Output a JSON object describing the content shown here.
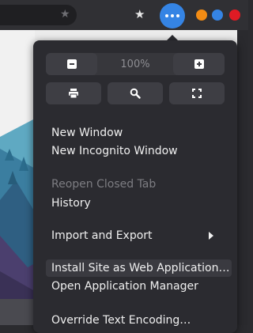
{
  "window": {
    "colors": {
      "accent": "#3584e4",
      "minimize": "#f38c14",
      "maximize": "#3584e4",
      "close": "#e01b24"
    }
  },
  "toolbar": {
    "url_star_icon": "star-icon",
    "bookmark_icon": "star-icon",
    "menu_icon": "more-horizontal-icon"
  },
  "menu": {
    "zoom": {
      "out_icon": "zoom-out-icon",
      "level": "100%",
      "in_icon": "zoom-in-icon"
    },
    "tools": [
      {
        "icon": "print-icon"
      },
      {
        "icon": "search-icon"
      },
      {
        "icon": "fullscreen-icon"
      }
    ],
    "items": [
      {
        "label": "New Window",
        "enabled": true
      },
      {
        "label": "New Incognito Window",
        "enabled": true
      },
      {
        "label": "Reopen Closed Tab",
        "enabled": false
      },
      {
        "label": "History",
        "enabled": true
      },
      {
        "label": "Import and Export",
        "enabled": true,
        "submenu": true
      },
      {
        "label": "Install Site as Web Application…",
        "enabled": true,
        "highlighted": true
      },
      {
        "label": "Open Application Manager",
        "enabled": true
      },
      {
        "label": "Override Text Encoding…",
        "enabled": true
      }
    ]
  }
}
